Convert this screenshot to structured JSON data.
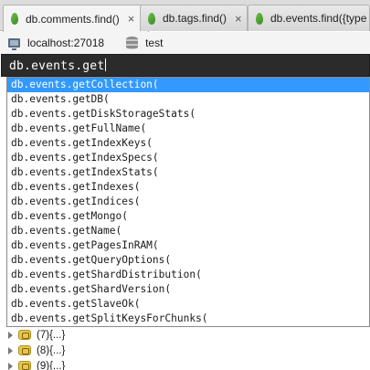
{
  "tabs": [
    {
      "label": "db.comments.find()",
      "close": "×",
      "active": true
    },
    {
      "label": "db.tags.find()",
      "close": "×",
      "active": false
    },
    {
      "label": "db.events.find({type : '",
      "close": "",
      "active": false
    }
  ],
  "connection": {
    "host": "localhost:27018",
    "database": "test"
  },
  "editor": {
    "query": "db.events.get"
  },
  "autocomplete": {
    "selected_index": 0,
    "items": [
      "db.events.getCollection(",
      "db.events.getDB(",
      "db.events.getDiskStorageStats(",
      "db.events.getFullName(",
      "db.events.getIndexKeys(",
      "db.events.getIndexSpecs(",
      "db.events.getIndexStats(",
      "db.events.getIndexes(",
      "db.events.getIndices(",
      "db.events.getMongo(",
      "db.events.getName(",
      "db.events.getPagesInRAM(",
      "db.events.getQueryOptions(",
      "db.events.getShardDistribution(",
      "db.events.getShardVersion(",
      "db.events.getSlaveOk(",
      "db.events.getSplitKeysForChunks("
    ]
  },
  "results": {
    "rows": [
      {
        "index": "(7)",
        "value": "{...}"
      },
      {
        "index": "(8)",
        "value": "{...}"
      },
      {
        "index": "(9)",
        "value": "{...}"
      }
    ]
  },
  "colors": {
    "selection": "#3399ff",
    "editor_bg": "#2b2b2b",
    "tab_icon": "#4f9e30"
  }
}
